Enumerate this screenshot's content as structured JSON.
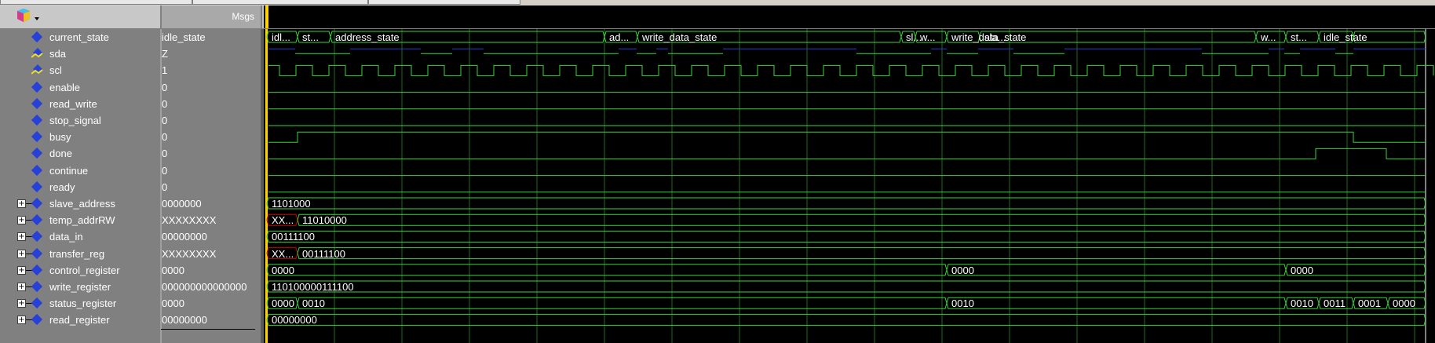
{
  "header": {
    "msgs_label": "Msgs"
  },
  "colors": {
    "wave_green": "#39d339",
    "wave_blue": "#2a3cd0",
    "cursor": "#ffd400",
    "grid": "#1e6b1e",
    "bus_red": "#d00000"
  },
  "signals": [
    {
      "name": "current_state",
      "value": "idle_state",
      "icon": "diamond-icon",
      "expandable": false
    },
    {
      "name": "sda",
      "value": "Z",
      "icon": "inout-pin-icon",
      "expandable": false
    },
    {
      "name": "scl",
      "value": "1",
      "icon": "inout-pin-icon",
      "expandable": false
    },
    {
      "name": "enable",
      "value": "0",
      "icon": "diamond-icon",
      "expandable": false
    },
    {
      "name": "read_write",
      "value": "0",
      "icon": "diamond-icon",
      "expandable": false
    },
    {
      "name": "stop_signal",
      "value": "0",
      "icon": "diamond-icon",
      "expandable": false
    },
    {
      "name": "busy",
      "value": "0",
      "icon": "diamond-icon",
      "expandable": false
    },
    {
      "name": "done",
      "value": "0",
      "icon": "diamond-icon",
      "expandable": false
    },
    {
      "name": "continue",
      "value": "0",
      "icon": "diamond-icon",
      "expandable": false
    },
    {
      "name": "ready",
      "value": "0",
      "icon": "diamond-icon",
      "expandable": false
    },
    {
      "name": "slave_address",
      "value": "0000000",
      "icon": "diamond-icon",
      "expandable": true
    },
    {
      "name": "temp_addrRW",
      "value": "XXXXXXXX",
      "icon": "diamond-icon",
      "expandable": true
    },
    {
      "name": "data_in",
      "value": "00000000",
      "icon": "diamond-icon",
      "expandable": true
    },
    {
      "name": "transfer_reg",
      "value": "XXXXXXXX",
      "icon": "diamond-icon",
      "expandable": true
    },
    {
      "name": "control_register",
      "value": "0000",
      "icon": "diamond-icon",
      "expandable": true
    },
    {
      "name": "write_register",
      "value": "000000000000000",
      "icon": "diamond-icon",
      "expandable": true
    },
    {
      "name": "status_register",
      "value": "0000",
      "icon": "diamond-icon",
      "expandable": true
    },
    {
      "name": "read_register",
      "value": "00000000",
      "icon": "diamond-icon",
      "expandable": true
    }
  ],
  "wave_labels": {
    "current_state": [
      "idl...",
      "st...",
      "address_state",
      "ad...",
      "write_data_state",
      "sl...",
      "w...",
      "write_data_state",
      "sla...",
      "w...",
      "st...",
      "idle_state"
    ],
    "slave_address": [
      "1101000"
    ],
    "temp_addrRW": [
      "XX...",
      "11010000"
    ],
    "data_in": [
      "00111100"
    ],
    "transfer_reg": [
      "XX...",
      "00111100"
    ],
    "control_register": [
      "0000",
      "0000",
      "0000"
    ],
    "write_register": [
      "110100000111100"
    ],
    "status_register": [
      "0000",
      "0010",
      "0010",
      "0010",
      "0011",
      "0001",
      "0000"
    ],
    "read_register": [
      "00000000"
    ]
  }
}
